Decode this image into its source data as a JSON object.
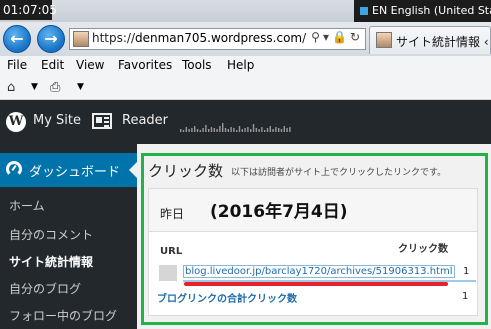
{
  "taskbar": {
    "clock": "01:07:05",
    "language": "EN English (United Sta"
  },
  "browser": {
    "url_prefix": "https://",
    "url_host": "denman705.wordpress.com",
    "url_suffix": "/",
    "tab_title": "サイト統計情報 ‹ D",
    "menu": [
      "File",
      "Edit",
      "View",
      "Favorites",
      "Tools",
      "Help"
    ]
  },
  "adminbar": {
    "mysite": "My Site",
    "reader": "Reader"
  },
  "sidebar": {
    "dashboard": "ダッシュボード",
    "items": [
      "ホーム",
      "自分のコメント",
      "サイト統計情報",
      "自分のブログ",
      "フォロー中のブログ"
    ],
    "current_index": 2
  },
  "clicks": {
    "title": "クリック数",
    "description": "以下は訪問者がサイト上でクリックしたリンクです。",
    "period": "昨日",
    "date_annotation": "(2016年7月4日)",
    "col_url": "URL",
    "col_clicks": "クリック数",
    "rows": [
      {
        "url": "blog.livedoor.jp/barclay1720/archives/51906313.html",
        "count": "1"
      }
    ],
    "total_label": "ブログリンクの合計クリック数",
    "total_count": "1"
  }
}
